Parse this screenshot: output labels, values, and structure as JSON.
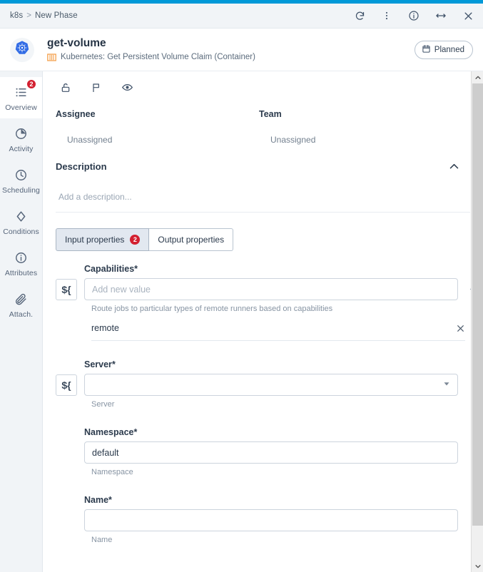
{
  "colors": {
    "accent": "#0099d8",
    "badge_red": "#d32030",
    "k8s_blue": "#326ce5",
    "orange": "#f4a04c",
    "text_dark": "#2b3a4c",
    "text_muted": "#8794a3"
  },
  "titlebar": {
    "breadcrumb_root": "k8s",
    "breadcrumb_separator": ">",
    "breadcrumb_current": "New Phase",
    "actions": [
      {
        "name": "refresh-icon",
        "label": "Refresh"
      },
      {
        "name": "more-vertical-icon",
        "label": "More options"
      },
      {
        "name": "info-icon",
        "label": "Info"
      },
      {
        "name": "expand-horizontal-icon",
        "label": "Expand"
      },
      {
        "name": "close-icon",
        "label": "Close"
      }
    ]
  },
  "entity": {
    "avatar_icon": "kubernetes-logo-icon",
    "title": "get-volume",
    "subtitle": "Kubernetes: Get Persistent Volume Claim (Container)",
    "subtitle_icon": "orange-bars-icon",
    "status": {
      "label": "Planned",
      "icon": "calendar-icon"
    }
  },
  "sidebar": {
    "items": [
      {
        "label": "Overview",
        "icon": "list-icon",
        "badge": "2",
        "active": true
      },
      {
        "label": "Activity",
        "icon": "pie-chart-icon",
        "badge": "",
        "active": false
      },
      {
        "label": "Scheduling",
        "icon": "clock-icon",
        "badge": "",
        "active": false
      },
      {
        "label": "Conditions",
        "icon": "diamond-icon",
        "badge": "",
        "active": false
      },
      {
        "label": "Attributes",
        "icon": "info-circle-icon",
        "badge": "",
        "active": false
      },
      {
        "label": "Attach.",
        "icon": "paperclip-icon",
        "badge": "",
        "active": false
      }
    ]
  },
  "toolbar": {
    "icons": [
      {
        "name": "lock-open-icon",
        "label": "Lock"
      },
      {
        "name": "flag-icon",
        "label": "Flag"
      },
      {
        "name": "eye-icon",
        "label": "Watch"
      }
    ]
  },
  "people": {
    "assignee_label": "Assignee",
    "assignee_value": "Unassigned",
    "team_label": "Team",
    "team_value": "Unassigned"
  },
  "description": {
    "title": "Description",
    "collapse_icon": "chevron-up-icon",
    "placeholder": "Add a description..."
  },
  "tabs": [
    {
      "label": "Input properties",
      "badge": "2",
      "active": true
    },
    {
      "label": "Output properties",
      "badge": "",
      "active": false
    }
  ],
  "form": {
    "capabilities": {
      "label": "Capabilities",
      "required": "*",
      "var_button": "${",
      "placeholder": "Add new value",
      "value": "",
      "add_icon": "plus-icon",
      "hint": "Route jobs to particular types of remote runners based on capabilities",
      "chips": [
        {
          "label": "remote",
          "remove_icon": "close-icon"
        }
      ]
    },
    "server": {
      "label": "Server",
      "required": "*",
      "var_button": "${",
      "value": "",
      "placeholder": "",
      "caret_icon": "chevron-down-icon",
      "hint": "Server"
    },
    "namespace": {
      "label": "Namespace",
      "required": "*",
      "value": "default",
      "placeholder": "",
      "hint": "Namespace"
    },
    "name": {
      "label": "Name",
      "required": "*",
      "value": "",
      "placeholder": "",
      "hint": "Name"
    }
  },
  "scrollbar": {
    "up_icon": "chevron-up-icon",
    "down_icon": "chevron-down-icon"
  }
}
